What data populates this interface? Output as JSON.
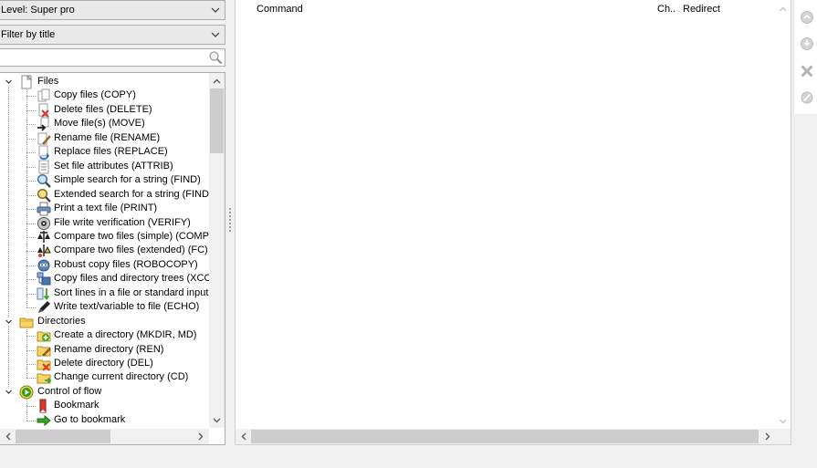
{
  "filters": {
    "level_value": "Level: Super pro",
    "title_filter_value": "Filter by title",
    "search_value": "",
    "search_placeholder": ""
  },
  "tree": [
    {
      "type": "category",
      "label": "Files",
      "icon": "file-icon",
      "expanded": true
    },
    {
      "type": "item",
      "label": "Copy files (COPY)",
      "icon": "copy-icon"
    },
    {
      "type": "item",
      "label": "Delete files (DELETE)",
      "icon": "delete-file-icon"
    },
    {
      "type": "item",
      "label": "Move file(s) (MOVE)",
      "icon": "move-icon"
    },
    {
      "type": "item",
      "label": "Rename file (RENAME)",
      "icon": "rename-icon"
    },
    {
      "type": "item",
      "label": "Replace files (REPLACE)",
      "icon": "replace-icon"
    },
    {
      "type": "item",
      "label": "Set file attributes (ATTRIB)",
      "icon": "attrib-icon"
    },
    {
      "type": "item",
      "label": "Simple search for a string (FIND)",
      "icon": "magnifier-icon"
    },
    {
      "type": "item",
      "label": "Extended search for a string (FINDS",
      "icon": "magnifier-gold-icon"
    },
    {
      "type": "item",
      "label": "Print a text file (PRINT)",
      "icon": "printer-icon"
    },
    {
      "type": "item",
      "label": "File write verification (VERIFY)",
      "icon": "verify-icon"
    },
    {
      "type": "item",
      "label": "Compare two files (simple) (COMP)",
      "icon": "compare-icon"
    },
    {
      "type": "item",
      "label": "Compare two files (extended) (FC)",
      "icon": "compare-extended-icon"
    },
    {
      "type": "item",
      "label": "Robust copy files (ROBOCOPY)",
      "icon": "robocopy-icon"
    },
    {
      "type": "item",
      "label": "Copy files and directory trees (XCOF",
      "icon": "xcopy-icon"
    },
    {
      "type": "item",
      "label": "Sort lines in a file or standard input (",
      "icon": "sort-icon"
    },
    {
      "type": "item",
      "label": "Write text/variable to file (ECHO)",
      "icon": "pen-icon"
    },
    {
      "type": "category",
      "label": "Directories",
      "icon": "folder-icon",
      "expanded": true
    },
    {
      "type": "item",
      "label": "Create a directory (MKDIR, MD)",
      "icon": "folder-add-icon"
    },
    {
      "type": "item",
      "label": "Rename directory (REN)",
      "icon": "folder-rename-icon"
    },
    {
      "type": "item",
      "label": "Delete directory (DEL)",
      "icon": "folder-delete-icon"
    },
    {
      "type": "item",
      "label": "Change current directory (CD)",
      "icon": "folder-change-icon"
    },
    {
      "type": "category",
      "label": "Control of flow",
      "icon": "play-circle-icon",
      "expanded": true
    },
    {
      "type": "item",
      "label": "Bookmark",
      "icon": "bookmark-icon"
    },
    {
      "type": "item",
      "label": "Go to bookmark",
      "icon": "goto-arrow-icon"
    }
  ],
  "table": {
    "columns": [
      "Command",
      "Ch...",
      "Redirect"
    ]
  },
  "colors": {
    "accent_gold": "#e8b829",
    "delete_red": "#d83b2b",
    "play_green": "#3aa52a",
    "disabled_gray": "#b8b8b8"
  }
}
